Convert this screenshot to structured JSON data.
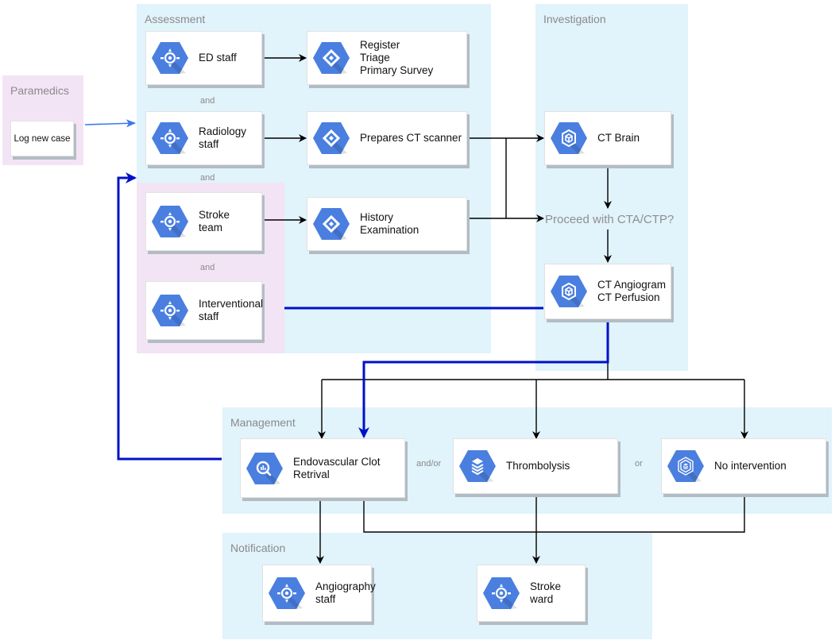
{
  "colors": {
    "lane_blue": "#e1f3fb",
    "lane_pink": "#f3e4f5",
    "icon_blue": "#4a7fe0",
    "edge_black": "#000000",
    "edge_highlight": "#0010c8",
    "edge_entry": "#3a78e8"
  },
  "lanes": {
    "paramedics": "Paramedics",
    "assessment": "Assessment",
    "investigation": "Investigation",
    "management": "Management",
    "notification": "Notification"
  },
  "nodes": {
    "log_new_case": "Log new case",
    "ed_staff": {
      "label": "ED staff",
      "icon": "compass-icon"
    },
    "register_triage": {
      "label": "Register\nTriage\nPrimary Survey",
      "icon": "diamond-icon"
    },
    "radiology_staff": {
      "label": "Radiology\nstaff",
      "icon": "compass-icon"
    },
    "prepares_ct": {
      "label": "Prepares CT scanner",
      "icon": "diamond-icon"
    },
    "stroke_team": {
      "label": "Stroke\nteam",
      "icon": "compass-icon"
    },
    "history_exam": {
      "label": "History\nExamination",
      "icon": "diamond-icon"
    },
    "interventional_staff": {
      "label": "Interventional\nstaff",
      "icon": "compass-icon"
    },
    "ct_brain": {
      "label": "CT Brain",
      "icon": "cube-icon"
    },
    "ct_angiogram": {
      "label": "CT Angiogram\nCT Perfusion",
      "icon": "cube-icon"
    },
    "endovascular": {
      "label": "Endovascular Clot\nRetrival",
      "icon": "magnifier-chart-icon"
    },
    "thrombolysis": {
      "label": "Thrombolysis",
      "icon": "layers-icon"
    },
    "no_intervention": {
      "label": "No intervention",
      "icon": "hexagon-spiral-icon"
    },
    "angiography_staff": {
      "label": "Angiography\nstaff",
      "icon": "compass-icon"
    },
    "stroke_ward": {
      "label": "Stroke ward",
      "icon": "compass-icon"
    }
  },
  "connector_labels": {
    "and_1": "and",
    "and_2": "and",
    "and_3": "and",
    "and_or": "and/or",
    "or": "or"
  },
  "decision": "Proceed with CTA/CTP?"
}
